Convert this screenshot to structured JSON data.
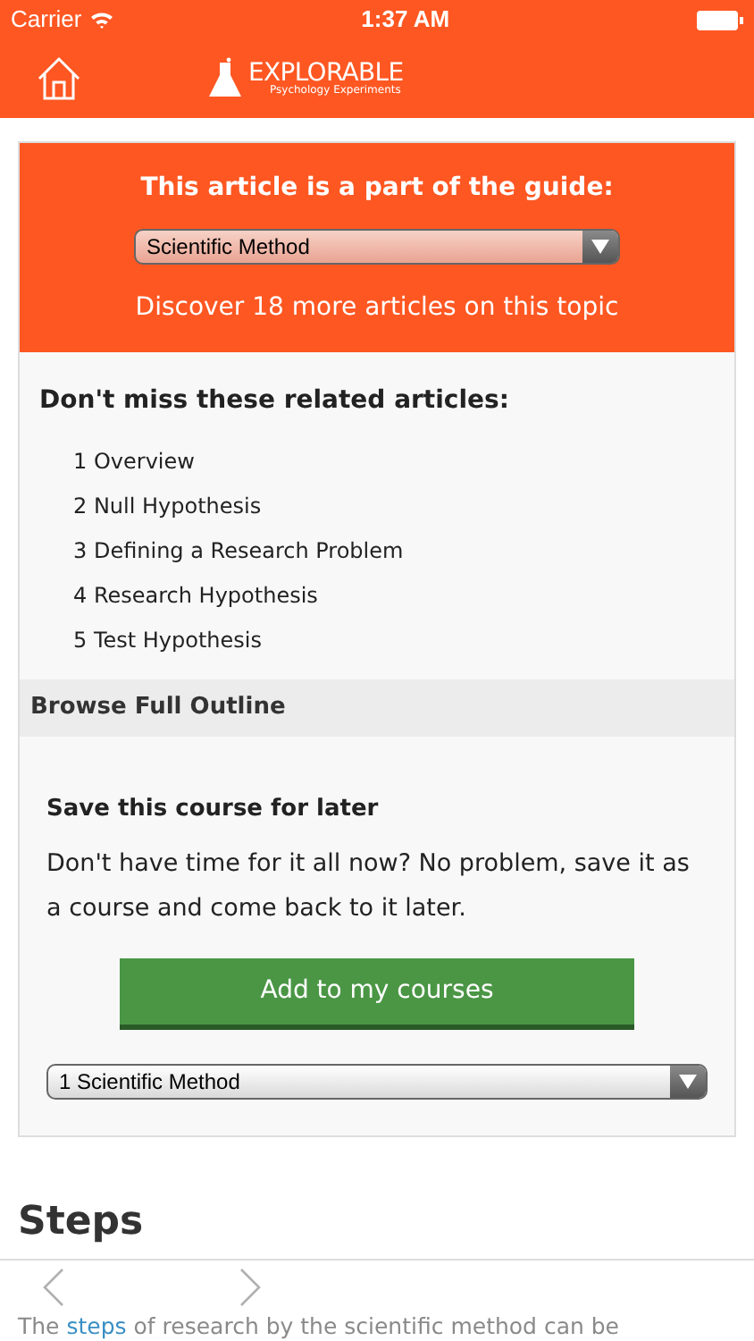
{
  "status_bar": {
    "carrier": "Carrier",
    "time": "1:37 AM"
  },
  "nav": {
    "logo_title": "EXPLORABLE",
    "logo_subtitle": "Psychology Experiments"
  },
  "guide": {
    "heading": "This article is a part of the guide:",
    "select_value": "Scientific Method",
    "discover": "Discover 18 more articles on this topic"
  },
  "related": {
    "heading": "Don't miss these related articles:",
    "items": [
      {
        "number": "1",
        "title": "Overview"
      },
      {
        "number": "2",
        "title": "Null Hypothesis"
      },
      {
        "number": "3",
        "title": "Defining a Research Problem"
      },
      {
        "number": "4",
        "title": "Research Hypothesis"
      },
      {
        "number": "5",
        "title": "Test Hypothesis"
      }
    ]
  },
  "outline": {
    "label": "Browse Full Outline"
  },
  "save": {
    "heading": "Save this course for later",
    "text": "Don't have time for it all now? No problem, save it as a course and come back to it later.",
    "button": "Add to my courses",
    "select_value": "1 Scientific Method"
  },
  "article": {
    "heading": "Steps",
    "para_before": "The",
    "link": "steps",
    "para_after": "of research by the scientific method can be"
  },
  "toolbar": {
    "back_disabled": false,
    "forward_disabled": false
  }
}
